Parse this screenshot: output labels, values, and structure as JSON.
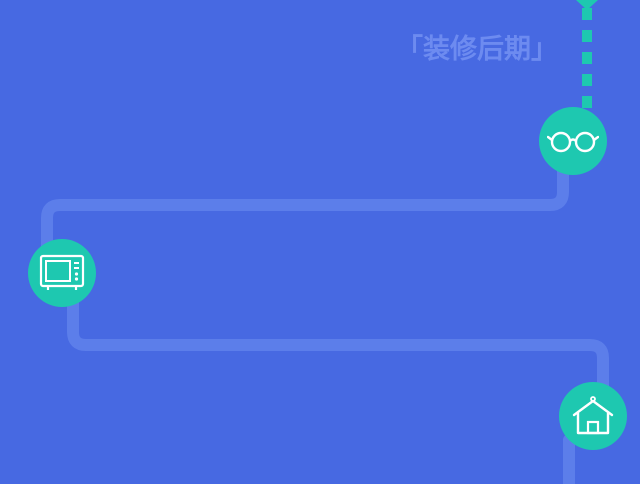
{
  "section": {
    "title": "「装修后期」"
  },
  "colors": {
    "background": "#4769e2",
    "path_line": "#5c7eea",
    "accent_teal": "#1ec8b0",
    "title_text": "#6d8bf0",
    "icon_stroke": "#ffffff"
  },
  "nodes": [
    {
      "icon": "glasses-icon"
    },
    {
      "icon": "tv-icon"
    },
    {
      "icon": "house-icon"
    }
  ]
}
